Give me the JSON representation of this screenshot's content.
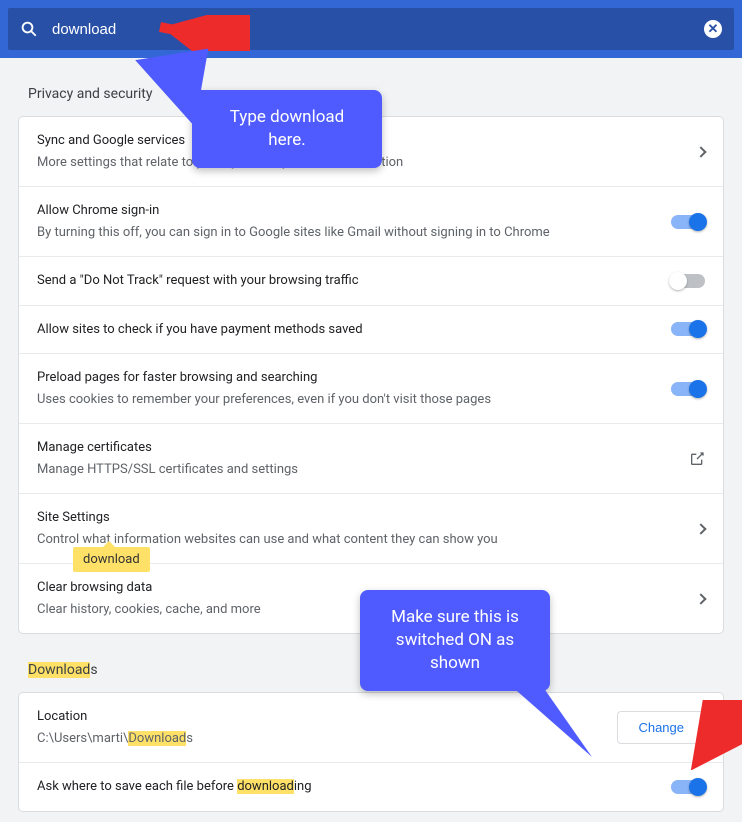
{
  "search": {
    "value": "download"
  },
  "sections": {
    "privacy": {
      "title": "Privacy and security",
      "rows": [
        {
          "title": "Sync and Google services",
          "sub": "More settings that relate to privacy, security, and data collection",
          "kind": "link"
        },
        {
          "title": "Allow Chrome sign-in",
          "sub": "By turning this off, you can sign in to Google sites like Gmail without signing in to Chrome",
          "kind": "toggle",
          "on": true
        },
        {
          "title": "Send a \"Do Not Track\" request with your browsing traffic",
          "sub": "",
          "kind": "toggle",
          "on": false
        },
        {
          "title": "Allow sites to check if you have payment methods saved",
          "sub": "",
          "kind": "toggle",
          "on": true
        },
        {
          "title": "Preload pages for faster browsing and searching",
          "sub": "Uses cookies to remember your preferences, even if you don't visit those pages",
          "kind": "toggle",
          "on": true
        },
        {
          "title": "Manage certificates",
          "sub": "Manage HTTPS/SSL certificates and settings",
          "kind": "launch"
        },
        {
          "title": "Site Settings",
          "sub": "Control what information websites can use and what content they can show you",
          "kind": "link"
        },
        {
          "title": "Clear browsing data",
          "sub": "Clear history, cookies, cache, and more",
          "kind": "link"
        }
      ]
    },
    "downloads": {
      "title_pre": "Download",
      "title_post": "s",
      "location_label": "Location",
      "location_pre": "C:\\Users\\marti\\",
      "location_hl": "Download",
      "location_post": "s",
      "change_label": "Change",
      "ask_pre": "Ask where to save each file before ",
      "ask_hl": "download",
      "ask_post": "ing",
      "ask_on": true
    }
  },
  "annotations": {
    "callout1": "Type download here.",
    "tooltip": "download",
    "callout2": "Make sure this is switched ON as shown"
  }
}
